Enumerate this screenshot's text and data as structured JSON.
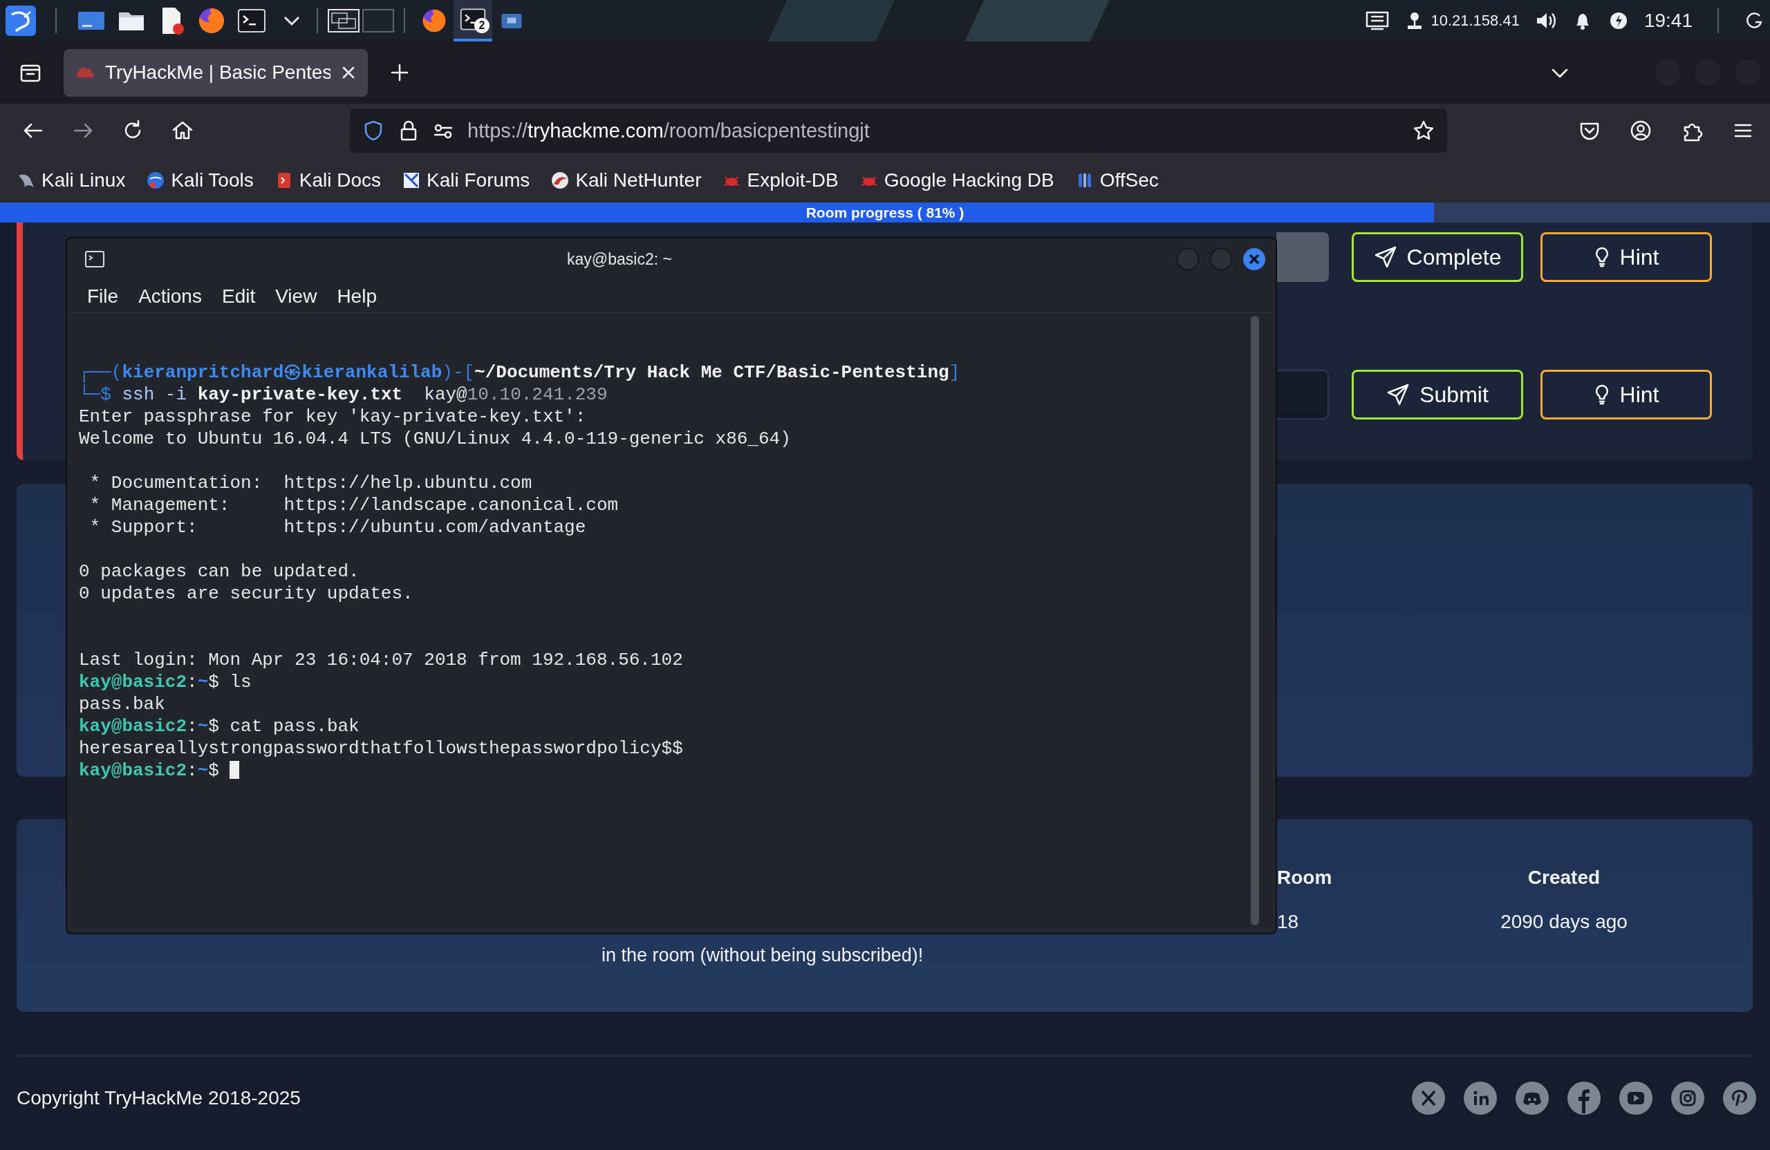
{
  "taskbar": {
    "launchers": [
      {
        "kind": "kali"
      },
      {
        "kind": "desktop"
      },
      {
        "kind": "files"
      },
      {
        "kind": "editor"
      },
      {
        "kind": "firefox"
      },
      {
        "kind": "terminal"
      },
      {
        "kind": "chevron"
      }
    ],
    "workspaces": [
      {
        "selected": true
      },
      {
        "selected": false
      }
    ],
    "tasks": [
      {
        "kind": "firefox",
        "selected": false
      },
      {
        "kind": "terminal",
        "selected": true,
        "badge": "2"
      },
      {
        "kind": "filemanager",
        "selected": false
      }
    ],
    "tray": {
      "ip": "10.21.158.41",
      "clock": "19:41"
    }
  },
  "browser": {
    "tabs": [
      {
        "title": "TryHackMe | Basic Pentes",
        "selected": true
      }
    ],
    "nav": {
      "back_enabled": true,
      "forward_enabled": false
    },
    "url": {
      "scheme": "https://",
      "host": "tryhackme.com",
      "path": "/room/basicpentestingjt"
    },
    "bookmarks": [
      {
        "label": "Kali Linux",
        "kind": "dragon"
      },
      {
        "label": "Kali Tools",
        "kind": "globe"
      },
      {
        "label": "Kali Docs",
        "kind": "doc"
      },
      {
        "label": "Kali Forums",
        "kind": "sword"
      },
      {
        "label": "Kali NetHunter",
        "kind": "swoosh"
      },
      {
        "label": "Exploit-DB",
        "kind": "bug"
      },
      {
        "label": "Google Hacking DB",
        "kind": "bug"
      },
      {
        "label": "OffSec",
        "kind": "bars"
      }
    ]
  },
  "progress": {
    "label": "Room progress ( 81% )",
    "level": 0.81
  },
  "page": {
    "task_rows": [
      {
        "field_disabled": true,
        "action": "Complete",
        "hint": "Hint"
      },
      {
        "field_disabled": false,
        "action": "Submit",
        "hint": "Hint"
      }
    ],
    "room_info": {
      "columns": [
        {
          "heading": "Room",
          "value": "18"
        },
        {
          "heading": "Created",
          "value": "2090 days ago"
        }
      ],
      "room_type_tail": "in the room (without being subscribed)!"
    },
    "footer": {
      "copyright": "Copyright TryHackMe 2018-2025",
      "social": [
        {
          "kind": "x"
        },
        {
          "kind": "linkedin"
        },
        {
          "kind": "discord"
        },
        {
          "kind": "facebook"
        },
        {
          "kind": "youtube"
        },
        {
          "kind": "instagram"
        },
        {
          "kind": "pinterest"
        }
      ]
    }
  },
  "terminal": {
    "title": "kay@basic2: ~",
    "menu": [
      "File",
      "Actions",
      "Edit",
      "View",
      "Help"
    ],
    "lines": [
      {
        "kind": "shell_header",
        "parts": [
          "┌──(",
          "kieranpritchard㉿kierankalilab",
          ")-[",
          "~/Documents/Try Hack Me CTF/Basic-Pentesting",
          "]"
        ]
      },
      {
        "kind": "shell_command",
        "parts": [
          "└─$ ",
          "ssh -i ",
          "kay-private-key.txt",
          "  kay@",
          "10.10.241.239"
        ]
      },
      {
        "kind": "output",
        "text": "Enter passphrase for key 'kay-private-key.txt':"
      },
      {
        "kind": "output",
        "text": "Welcome to Ubuntu 16.04.4 LTS (GNU/Linux 4.4.0-119-generic x86_64)"
      },
      {
        "kind": "blank"
      },
      {
        "kind": "output",
        "text": " * Documentation:  https://help.ubuntu.com"
      },
      {
        "kind": "output",
        "text": " * Management:     https://landscape.canonical.com"
      },
      {
        "kind": "output",
        "text": " * Support:        https://ubuntu.com/advantage"
      },
      {
        "kind": "blank"
      },
      {
        "kind": "output",
        "text": "0 packages can be updated."
      },
      {
        "kind": "output",
        "text": "0 updates are security updates."
      },
      {
        "kind": "blank"
      },
      {
        "kind": "blank"
      },
      {
        "kind": "output",
        "text": "Last login: Mon Apr 23 16:04:07 2018 from 192.168.56.102"
      },
      {
        "kind": "prompt",
        "parts": [
          "kay@basic2",
          ":",
          "~",
          "$ ls"
        ]
      },
      {
        "kind": "output",
        "text": "pass.bak"
      },
      {
        "kind": "prompt",
        "parts": [
          "kay@basic2",
          ":",
          "~",
          "$ cat pass.bak"
        ]
      },
      {
        "kind": "output",
        "text": "heresareallystrongpasswordthatfollowsthepasswordpolicy$$"
      },
      {
        "kind": "prompt",
        "cursor": true,
        "parts": [
          "kay@basic2",
          ":",
          "~",
          "$ "
        ]
      }
    ]
  }
}
